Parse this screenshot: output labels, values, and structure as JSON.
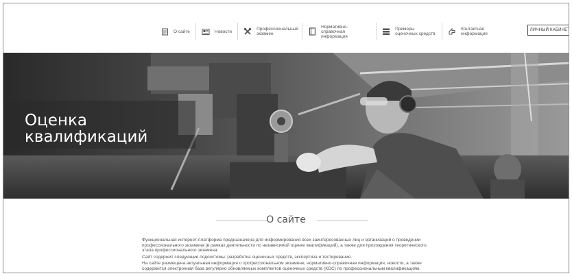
{
  "nav": {
    "items": [
      {
        "label": "О сайте",
        "icon": "document-icon"
      },
      {
        "label": "Новости",
        "icon": "newspaper-icon"
      },
      {
        "label": "Профессиональный экзамен",
        "icon": "tools-icon"
      },
      {
        "label": "Нормативно-справочная информация",
        "icon": "book-icon"
      },
      {
        "label": "Примеры оценочных средств",
        "icon": "stack-icon"
      },
      {
        "label": "Контактная информация",
        "icon": "contact-icon"
      }
    ]
  },
  "header": {
    "cabinet_label": "ЛИЧНЫЙ КАБИНЕТ"
  },
  "hero": {
    "title_line1": "Оценка",
    "title_line2": "квалификаций"
  },
  "about": {
    "heading": "О сайте",
    "paragraph1": "Функциональная интернет-платформа предназначена для информирования всех заинтересованных лиц и организаций о проведении профессионального экзамена (в рамках деятельности по независимой оценке квалификаций), а также для прохождения теоретического этапа профессионального экзамена.",
    "paragraph2": "Сайт содержит следующие подсистемы: разработка оценочных средств, экспертиза и тестирование.",
    "paragraph3": "На сайте размещена актуальная информация о профессиональном экзамене, нормативно-справочная информация, новости, а также содержится электронная база регулярно обновляемых комплектов оценочных средств (КОС) по профессиональным квалификациям."
  }
}
